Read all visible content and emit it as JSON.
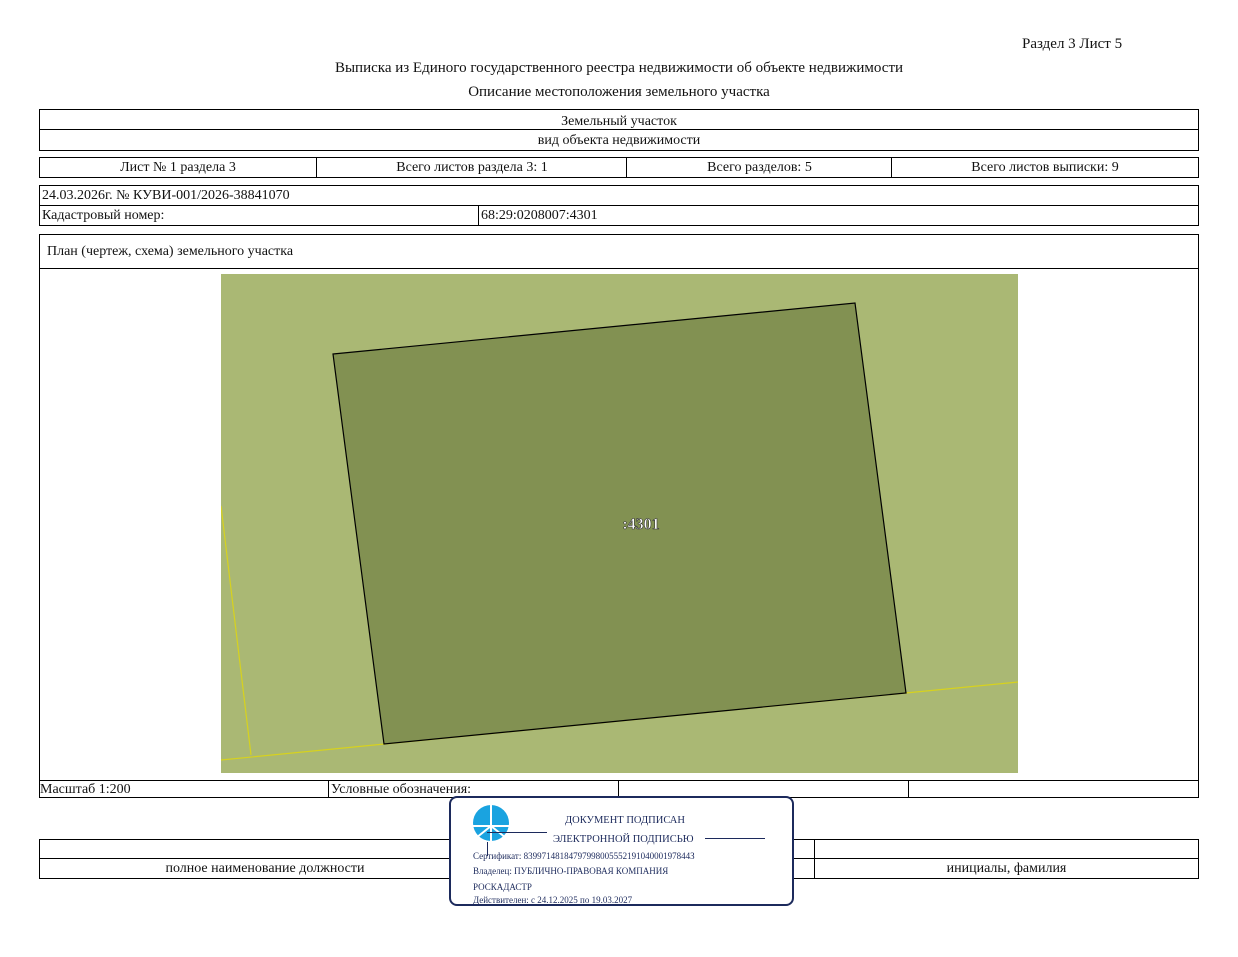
{
  "header": {
    "section_sheet": "Раздел 3    Лист 5",
    "title": "Выписка из Единого государственного реестра недвижимости об объекте недвижимости",
    "subtitle": "Описание местоположения земельного участка"
  },
  "object": {
    "type": "Земельный участок",
    "type_caption": "вид объекта недвижимости"
  },
  "sheet_info": {
    "sheet": "Лист № 1 раздела 3",
    "total_sheets_section": "Всего листов раздела 3: 1",
    "total_sections": "Всего разделов: 5",
    "total_sheets_extract": "Всего листов выписки: 9"
  },
  "record": {
    "date_number": "24.03.2026г. № КУВИ-001/2026-38841070",
    "cadastral_label": "Кадастровый номер:",
    "cadastral_value": "68:29:0208007:4301"
  },
  "plan": {
    "caption": "План (чертеж, схема) земельного участка",
    "parcel_label": ":4301",
    "colors": {
      "background": "#aab874",
      "parcel": "#829152",
      "boundary_line": "#d7d21e"
    }
  },
  "legend_row": {
    "scale": "Масштаб 1:200",
    "legend_label": "Условные обозначения:"
  },
  "signature_row": {
    "position_caption": "полное наименование должности",
    "name_caption": "инициалы, фамилия"
  },
  "stamp": {
    "line1": "ДОКУМЕНТ ПОДПИСАН",
    "line2": "ЭЛЕКТРОННОЙ ПОДПИСЬЮ",
    "certificate": "Сертификат: 8399714818479799800555219104000197844З",
    "owner_line1": "Владелец: ПУБЛИЧНО-ПРАВОВАЯ КОМПАНИЯ",
    "owner_line2": "РОСКАДАСТР",
    "validity": "Действителен: с 24.12.2025 по 19.03.2027",
    "logo_icon": "roskadastr-logo-icon",
    "border_color": "#1c2a5c",
    "logo_color": "#1aa3e0"
  }
}
